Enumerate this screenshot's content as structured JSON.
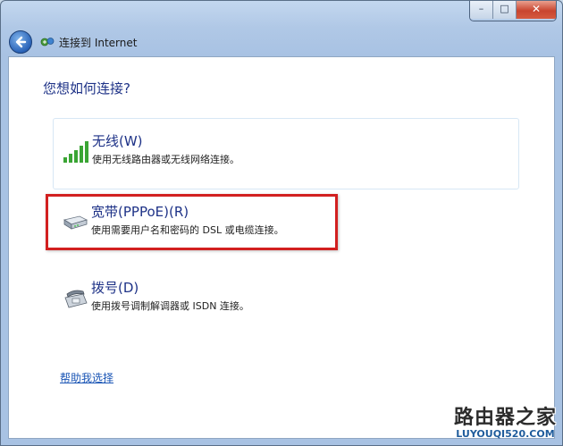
{
  "window": {
    "controls": {
      "minimize": "–",
      "maximize": "□",
      "close": "✕"
    }
  },
  "nav": {
    "title": "连接到 Internet",
    "back_icon": "back-arrow-icon",
    "wizard_icon": "network-connect-icon"
  },
  "main": {
    "heading": "您想如何连接?",
    "options": [
      {
        "title": "无线(W)",
        "description": "使用无线路由器或无线网络连接。",
        "icon": "wireless-signal-icon",
        "state": "hover"
      },
      {
        "title": "宽带(PPPoE)(R)",
        "description": "使用需要用户名和密码的 DSL 或电缆连接。",
        "icon": "broadband-modem-icon",
        "state": "highlighted"
      },
      {
        "title": "拨号(D)",
        "description": "使用拨号调制解调器或 ISDN 连接。",
        "icon": "dialup-phone-icon",
        "state": "normal"
      }
    ],
    "help_link": "帮助我选择"
  },
  "watermark": {
    "main": "路由器之家",
    "sub": "LUYOUQI520.COM"
  },
  "colors": {
    "heading": "#1e3287",
    "highlight_border": "#d22020",
    "link": "#1a55b5"
  }
}
